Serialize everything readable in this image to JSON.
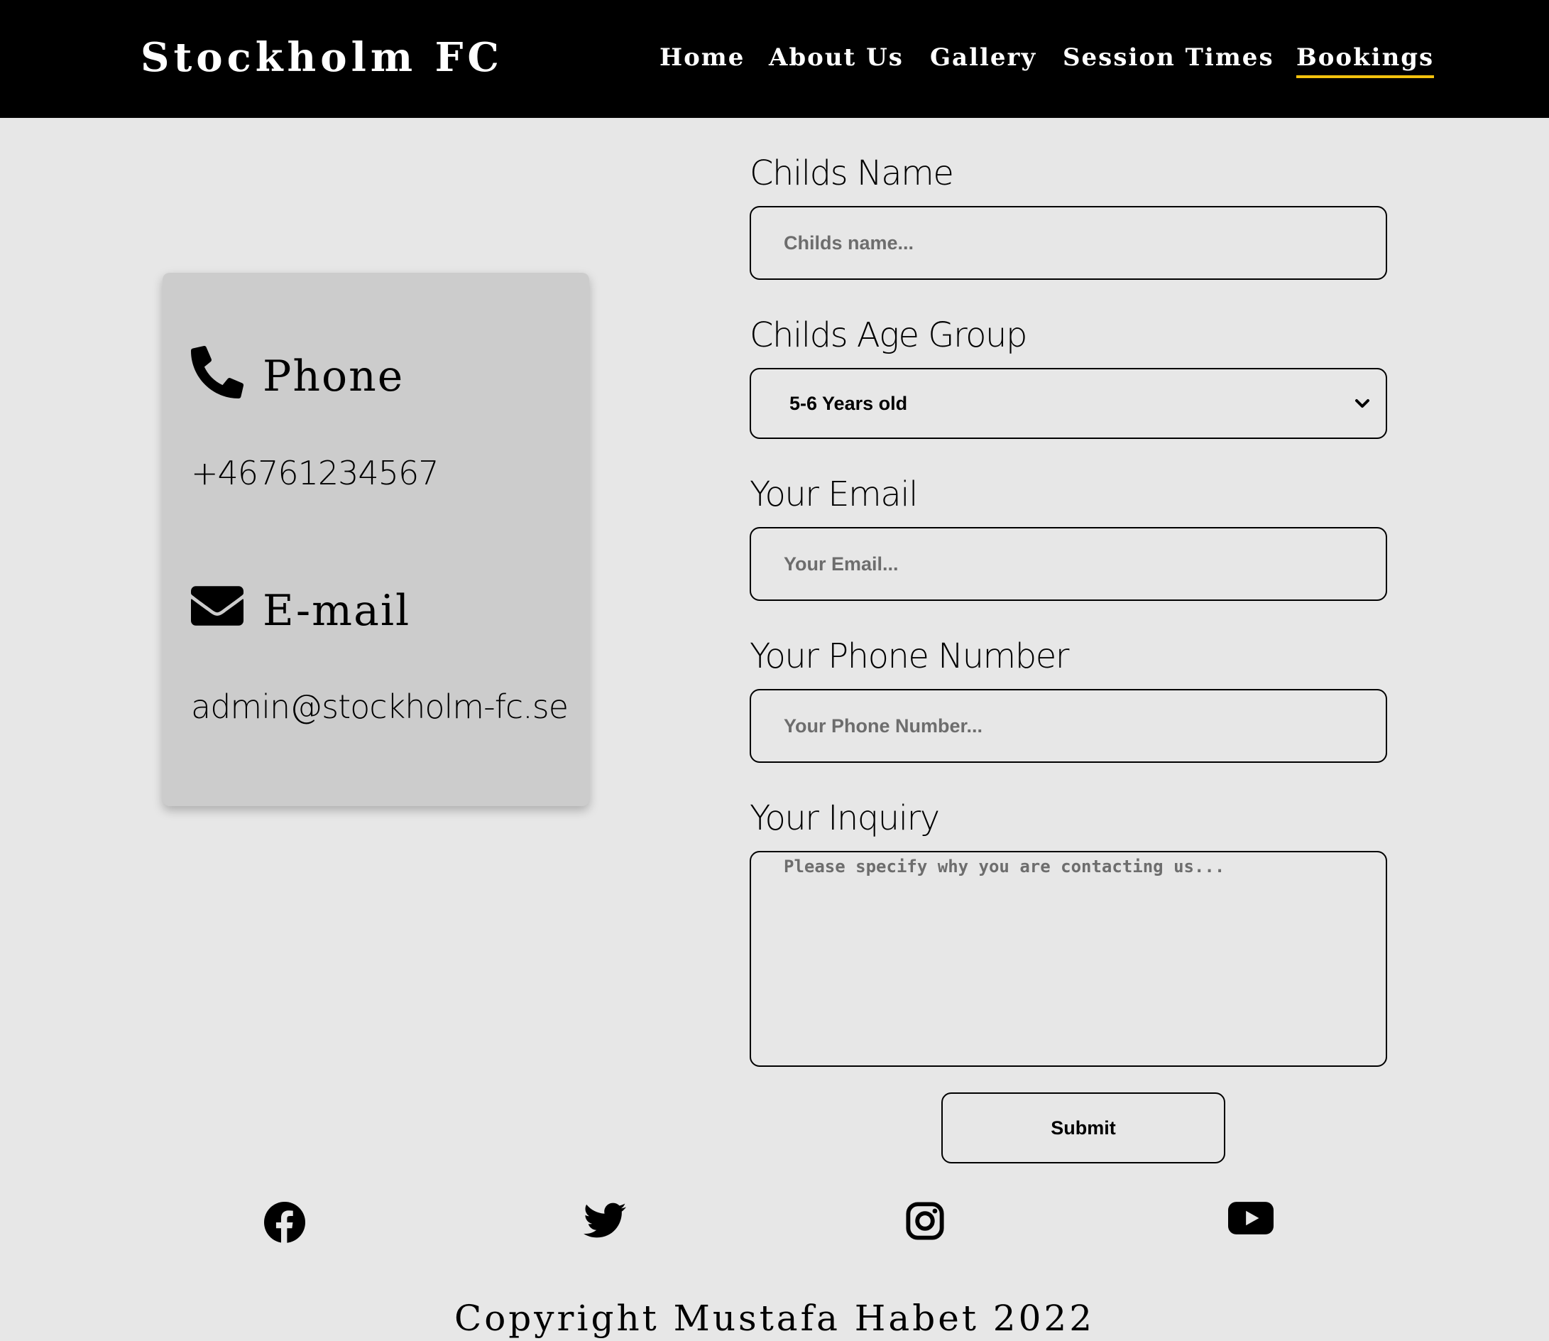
{
  "header": {
    "logo": "Stockholm FC",
    "nav": [
      {
        "label": "Home",
        "active": false
      },
      {
        "label": "About Us",
        "active": false
      },
      {
        "label": "Gallery",
        "active": false
      },
      {
        "label": "Session Times",
        "active": false
      },
      {
        "label": "Bookings",
        "active": true
      }
    ],
    "active_underline_color": "#f4c20d",
    "background_color": "#000000"
  },
  "contact_card": {
    "phone": {
      "icon": "phone-icon",
      "heading": "Phone",
      "value": "+46761234567"
    },
    "email": {
      "icon": "envelope-icon",
      "heading": "E-mail",
      "value": "admin@stockholm-fc.se"
    }
  },
  "form": {
    "child_name": {
      "label": "Childs Name",
      "placeholder": "Childs name..."
    },
    "age_group": {
      "label": "Childs Age Group",
      "selected": "5-6 Years old"
    },
    "email": {
      "label": "Your Email",
      "placeholder": "Your Email..."
    },
    "phone": {
      "label": "Your Phone Number",
      "placeholder": "Your Phone Number..."
    },
    "inquiry": {
      "label": "Your Inquiry",
      "placeholder": "Please specify why you are contacting us..."
    },
    "submit_label": "Submit"
  },
  "footer": {
    "social": [
      "facebook-icon",
      "twitter-icon",
      "instagram-icon",
      "youtube-icon"
    ],
    "copyright": "Copyright Mustafa Habet 2022"
  }
}
